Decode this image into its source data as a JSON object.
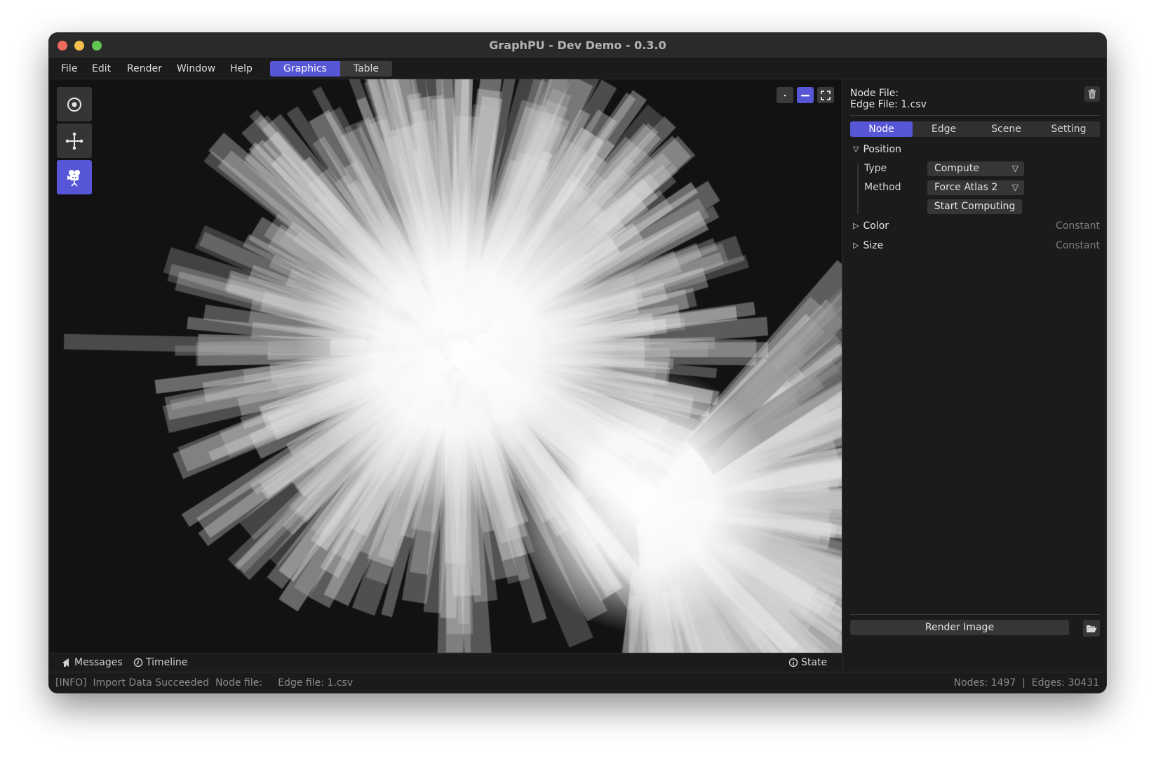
{
  "window": {
    "title": "GraphPU - Dev Demo - 0.3.0",
    "accent_color": "#5656d6"
  },
  "menubar": {
    "items": [
      "File",
      "Edit",
      "Render",
      "Window",
      "Help"
    ],
    "mode_tabs": [
      {
        "label": "Graphics",
        "active": true
      },
      {
        "label": "Table",
        "active": false
      }
    ]
  },
  "toolbar": {
    "tools": [
      {
        "name": "target-icon",
        "active": false
      },
      {
        "name": "move-icon",
        "active": false
      },
      {
        "name": "camera-icon",
        "active": true
      }
    ]
  },
  "viewport": {
    "corner_buttons": [
      {
        "name": "point-mode-icon",
        "active": false
      },
      {
        "name": "line-mode-icon",
        "active": true
      },
      {
        "name": "fullscreen-icon",
        "active": false
      }
    ]
  },
  "panel": {
    "node_file_label": "Node File:",
    "edge_file_label": "Edge File: 1.csv",
    "tabs": [
      {
        "label": "Node",
        "active": true
      },
      {
        "label": "Edge",
        "active": false
      },
      {
        "label": "Scene",
        "active": false
      },
      {
        "label": "Setting",
        "active": false
      }
    ],
    "position": {
      "title": "Position",
      "expanded": true,
      "type_label": "Type",
      "type_value": "Compute",
      "method_label": "Method",
      "method_value": "Force Atlas 2",
      "start_button": "Start Computing"
    },
    "color": {
      "title": "Color",
      "value": "Constant"
    },
    "size": {
      "title": "Size",
      "value": "Constant"
    },
    "render_button": "Render Image"
  },
  "bottom": {
    "messages_tab": "Messages",
    "timeline_tab": "Timeline",
    "state_tab": "State",
    "log": "[INFO]  Import Data Succeeded  Node file:     Edge file: 1.csv",
    "stats": "Nodes: 1497  |  Edges: 30431"
  }
}
